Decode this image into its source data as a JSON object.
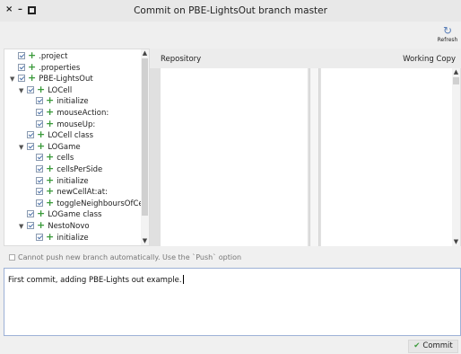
{
  "window": {
    "title": "Commit on PBE-LightsOut branch master",
    "close_glyph": "×",
    "minimize_glyph": "–"
  },
  "toolbar": {
    "refresh_label": "Refresh",
    "refresh_icon": "refresh-icon"
  },
  "tree": {
    "items": [
      {
        "label": ".project",
        "expanded": null,
        "checked": true,
        "added": true
      },
      {
        "label": ".properties",
        "expanded": null,
        "checked": true,
        "added": true
      },
      {
        "label": "PBE-LightsOut",
        "expanded": true,
        "checked": true,
        "added": true
      },
      {
        "label": "LOCell",
        "expanded": true,
        "checked": true,
        "added": true
      },
      {
        "label": "initialize",
        "expanded": null,
        "checked": true,
        "added": true
      },
      {
        "label": "mouseAction:",
        "expanded": null,
        "checked": true,
        "added": true
      },
      {
        "label": "mouseUp:",
        "expanded": null,
        "checked": true,
        "added": true
      },
      {
        "label": "LOCell class",
        "expanded": null,
        "checked": true,
        "added": true
      },
      {
        "label": "LOGame",
        "expanded": true,
        "checked": true,
        "added": true
      },
      {
        "label": "cells",
        "expanded": null,
        "checked": true,
        "added": true
      },
      {
        "label": "cellsPerSide",
        "expanded": null,
        "checked": true,
        "added": true
      },
      {
        "label": "initialize",
        "expanded": null,
        "checked": true,
        "added": true
      },
      {
        "label": "newCellAt:at:",
        "expanded": null,
        "checked": true,
        "added": true
      },
      {
        "label": "toggleNeighboursOfCellAt:",
        "expanded": null,
        "checked": true,
        "added": true
      },
      {
        "label": "LOGame class",
        "expanded": null,
        "checked": true,
        "added": true
      },
      {
        "label": "NestoNovo",
        "expanded": true,
        "checked": true,
        "added": true
      },
      {
        "label": "initialize",
        "expanded": null,
        "checked": true,
        "added": true
      }
    ],
    "expanded_glyph": "▼",
    "added_glyph": "+"
  },
  "diff": {
    "left_header": "Repository",
    "right_header": "Working Copy"
  },
  "notice": {
    "text": "Cannot push new branch automatically. Use the `Push` option"
  },
  "commit": {
    "message": "First commit, adding PBE-Lights out example.",
    "button_label": "Commit",
    "button_check": "✔"
  },
  "colors": {
    "added_green": "#3a9a3a",
    "selection_border": "#9db1d6",
    "refresh_blue": "#5a7fb8"
  }
}
